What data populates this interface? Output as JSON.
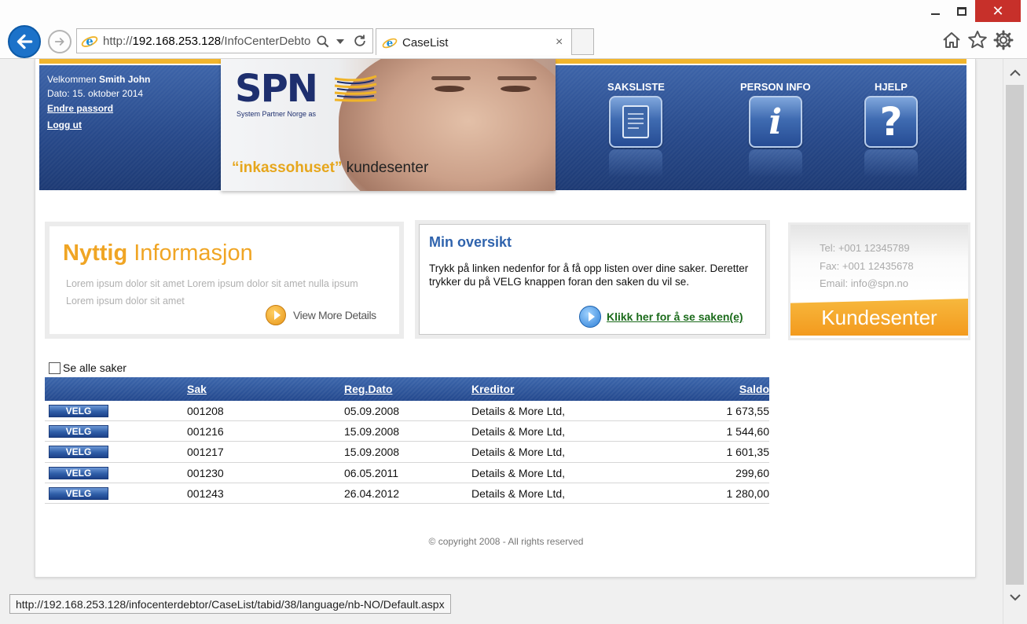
{
  "browser": {
    "address_prefix": "http://",
    "address_host": "192.168.253.128",
    "address_path": "/InfoCenterDebto",
    "tab_title": "CaseList",
    "tab_close": "×",
    "status_url": "http://192.168.253.128/infocenterdebtor/CaseList/tabid/38/language/nb-NO/Default.aspx"
  },
  "header": {
    "welcome_prefix": "Velkommen ",
    "user_name": "Smith John",
    "date_text": "Dato: 15. oktober 2014",
    "change_password": "Endre passord",
    "logout": "Logg ut",
    "banner": {
      "logo": "SPN",
      "logo_sub": "System Partner Norge as",
      "slogan_quote": "“inkassohuset”",
      "slogan_rest": " kundesenter"
    },
    "nav": [
      {
        "label": "SAKSLISTE",
        "icon": "document-icon"
      },
      {
        "label": "PERSON INFO",
        "icon": "info-icon"
      },
      {
        "label": "HJELP",
        "icon": "help-question-icon"
      }
    ]
  },
  "nyttig": {
    "title_a": "Nyttig",
    "title_b": " Informasjon",
    "body": "Lorem ipsum dolor sit amet Lorem ipsum dolor sit amet nulla ipsum Lorem ipsum dolor sit amet",
    "more_label": "View More Details"
  },
  "oversikt": {
    "title": "Min oversikt",
    "text": "Trykk på linken nedenfor for å få opp listen over dine saker. Deretter trykker du på VELG knappen foran den saken du vil se.",
    "link": "Klikk her for å se saken(e)"
  },
  "contact": {
    "tel": "Tel: +001 12345789",
    "fax": "Fax: +001 12435678",
    "email": "Email: info@spn.no",
    "banner": "Kundesenter"
  },
  "cases": {
    "show_all_label": "Se alle saker",
    "select_label": "VELG",
    "headers": {
      "sak": "Sak",
      "dato": "Reg.Dato",
      "kreditor": "Kreditor",
      "saldo": "Saldo"
    },
    "rows": [
      {
        "sak": "001208",
        "dato": "05.09.2008",
        "kreditor": "Details & More Ltd,",
        "saldo": "1 673,55"
      },
      {
        "sak": "001216",
        "dato": "15.09.2008",
        "kreditor": "Details & More Ltd,",
        "saldo": "1 544,60"
      },
      {
        "sak": "001217",
        "dato": "15.09.2008",
        "kreditor": "Details & More Ltd,",
        "saldo": "1 601,35"
      },
      {
        "sak": "001230",
        "dato": "06.05.2011",
        "kreditor": "Details & More Ltd,",
        "saldo": "299,60"
      },
      {
        "sak": "001243",
        "dato": "26.04.2012",
        "kreditor": "Details & More Ltd,",
        "saldo": "1 280,00"
      }
    ]
  },
  "footer": {
    "copyright": "© copyright 2008 - All rights reserved"
  },
  "colors": {
    "header_blue": "#2a4c8d",
    "gold": "#f1b52d",
    "link_green": "#1b6b1b",
    "title_blue": "#2f63ad",
    "orange": "#f0a524",
    "close_red": "#c7302a"
  }
}
